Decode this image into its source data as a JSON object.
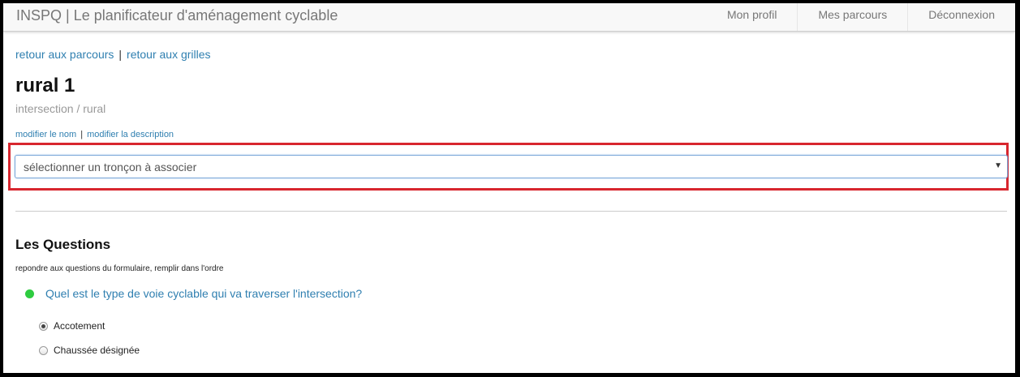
{
  "navbar": {
    "brand": "INSPQ | Le planificateur d'aménagement cyclable",
    "items": [
      {
        "label": "Mon profil"
      },
      {
        "label": "Mes parcours"
      },
      {
        "label": "Déconnexion"
      }
    ]
  },
  "breadcrumb": {
    "back_parcours": "retour aux parcours",
    "separator": "|",
    "back_grilles": "retour aux grilles"
  },
  "page": {
    "title": "rural 1",
    "subtitle": "intersection / rural"
  },
  "edit_links": {
    "rename": "modifier le nom",
    "separator": "|",
    "edit_description": "modifier la description"
  },
  "segment_select": {
    "value": "sélectionner un tronçon à associer",
    "caret": "▼"
  },
  "questions": {
    "title": "Les Questions",
    "instructions": "repondre aux questions du formulaire, remplir dans l'ordre",
    "items": [
      {
        "text": "Quel est le type de voie cyclable qui va traverser l'intersection?",
        "status_color": "#2ecc40",
        "options": [
          {
            "label": "Accotement",
            "checked": true
          },
          {
            "label": "Chaussée désignée",
            "checked": false
          }
        ]
      }
    ]
  },
  "colors": {
    "link": "#2f7fb0",
    "highlight": "#d8262e",
    "status_ok": "#2ecc40"
  }
}
